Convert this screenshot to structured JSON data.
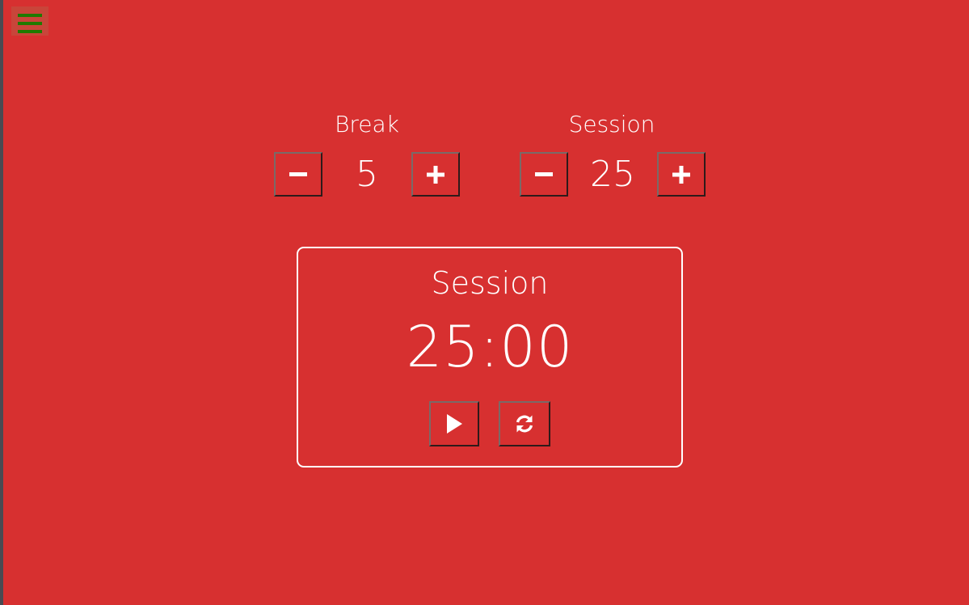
{
  "app": {
    "menu_icon": "hamburger-menu-icon",
    "menu_icon_color": "#1F7A00",
    "background_color": "#D73030",
    "accent_color": "#FFFFFF"
  },
  "break_control": {
    "label": "Break",
    "value": "5",
    "decrement_icon": "minus-icon",
    "increment_icon": "plus-icon"
  },
  "session_control": {
    "label": "Session",
    "value": "25",
    "decrement_icon": "minus-icon",
    "increment_icon": "plus-icon"
  },
  "timer": {
    "label": "Session",
    "time": "25:00",
    "play_icon": "play-icon",
    "reset_icon": "refresh-icon"
  }
}
